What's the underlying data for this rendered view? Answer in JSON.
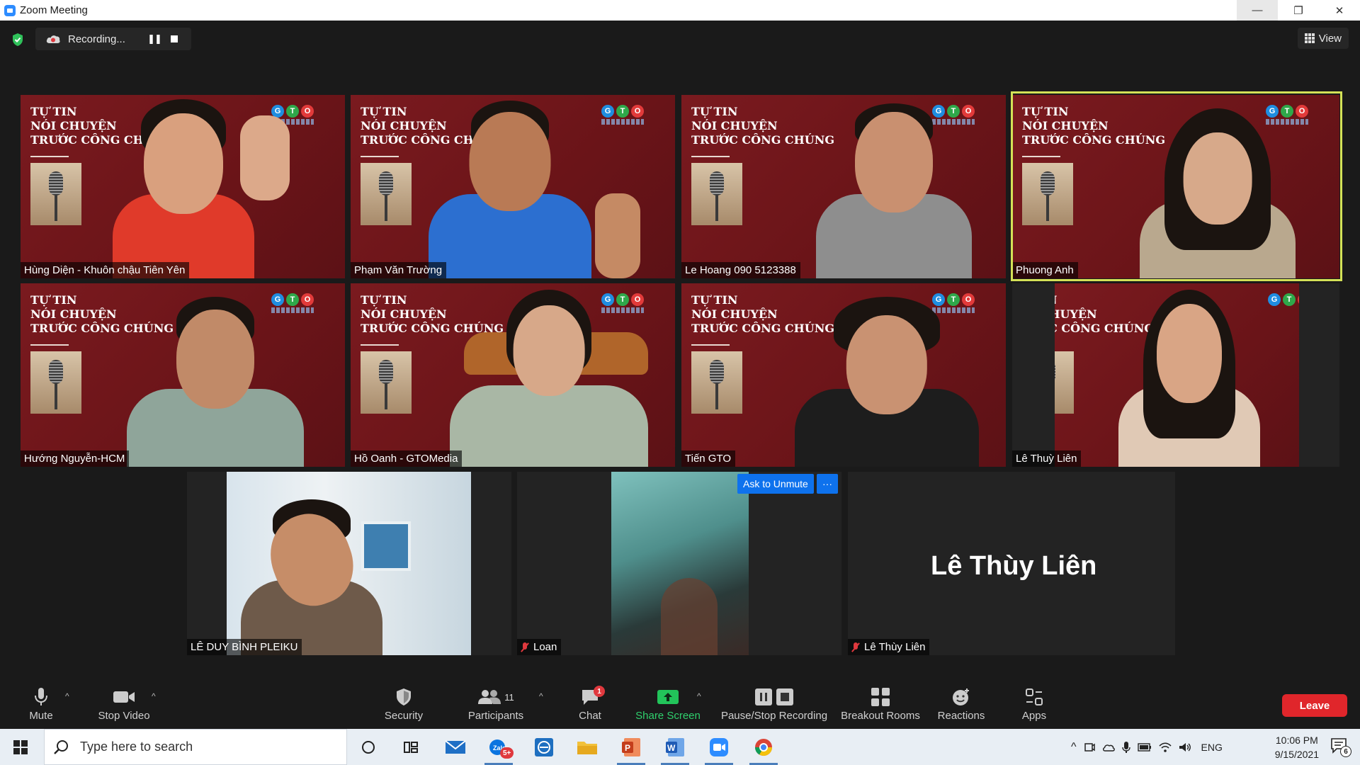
{
  "window": {
    "title": "Zoom Meeting",
    "minimize": "—",
    "restore": "❐",
    "close": "✕"
  },
  "recording": {
    "label": "Recording...",
    "pause_label": "❚❚"
  },
  "view_button": {
    "label": "View"
  },
  "slide": {
    "line1": "TỰ TIN",
    "line2": "NÓI CHUYỆN",
    "line3": "TRƯỚC CÔNG CHÚNG",
    "logo_letters": [
      "G",
      "T",
      "O"
    ]
  },
  "participants": [
    {
      "name": "Hùng Diện - Khuôn chậu Tiên Yên"
    },
    {
      "name": "Phạm Văn Trường"
    },
    {
      "name": "Le Hoang 090 5123388"
    },
    {
      "name": "Phuong Anh"
    },
    {
      "name": "Hướng Nguyễn-HCM"
    },
    {
      "name": "Hồ Oanh - GTOMedia"
    },
    {
      "name": "Tiến GTO"
    },
    {
      "name": "Lê Thuỳ Liên"
    },
    {
      "name": "LÊ DUY BÌNH PLEIKU"
    },
    {
      "name": "Loan"
    },
    {
      "name": "Lê Thùy Liên",
      "display_name": "Lê Thùy Liên"
    }
  ],
  "ask_unmute": {
    "label": "Ask to Unmute",
    "more": "···"
  },
  "toolbar": {
    "mute": "Mute",
    "stop_video": "Stop Video",
    "security": "Security",
    "participants": "Participants",
    "participants_count": "11",
    "chat": "Chat",
    "chat_badge": "1",
    "share_screen": "Share Screen",
    "pause_stop_recording": "Pause/Stop Recording",
    "breakout_rooms": "Breakout Rooms",
    "reactions": "Reactions",
    "apps": "Apps",
    "leave": "Leave",
    "caret": "^"
  },
  "taskbar": {
    "search_placeholder": "Type here to search",
    "zalo_badge": "5+",
    "language": "ENG",
    "time": "10:06 PM",
    "date": "9/15/2021",
    "notification_count": "6"
  },
  "colors": {
    "slide_red": "#6e161b",
    "active_speaker": "#d4e157",
    "leave_red": "#e0262b",
    "share_green": "#2fd06d",
    "ask_unmute_blue": "#0e72ed"
  }
}
